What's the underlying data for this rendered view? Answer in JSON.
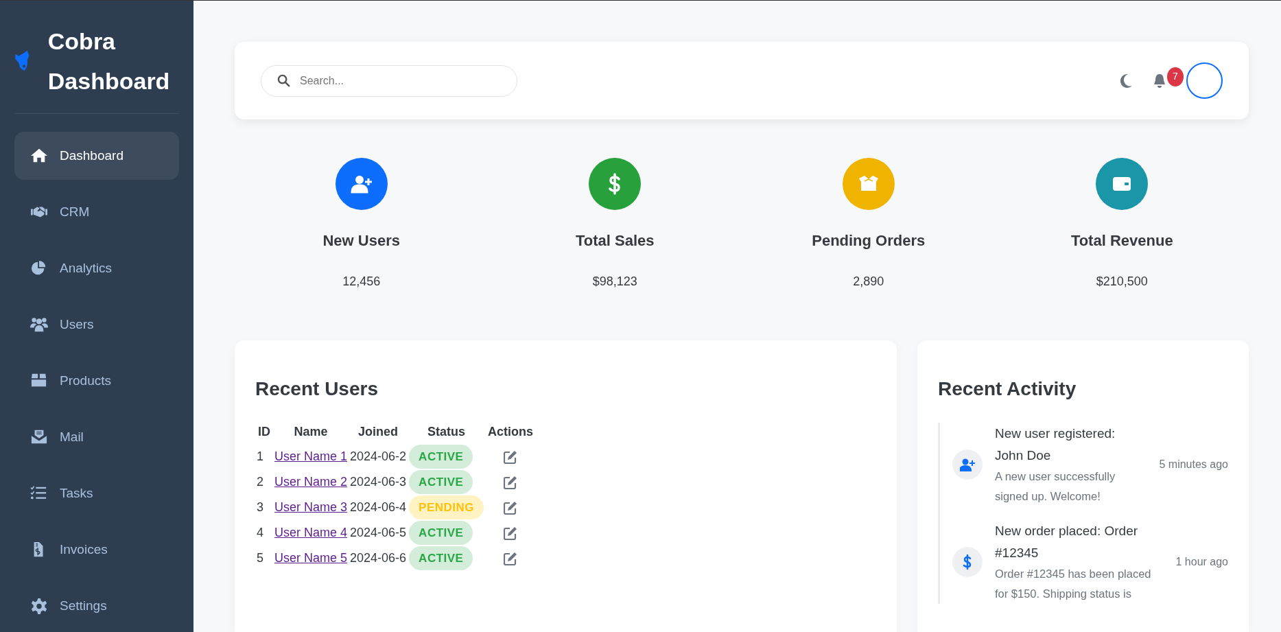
{
  "brand": {
    "title": "Cobra Dashboard"
  },
  "sidebar": {
    "items": [
      {
        "label": "Dashboard",
        "selected": true
      },
      {
        "label": "CRM",
        "selected": false
      },
      {
        "label": "Analytics",
        "selected": false
      },
      {
        "label": "Users",
        "selected": false
      },
      {
        "label": "Products",
        "selected": false
      },
      {
        "label": "Mail",
        "selected": false
      },
      {
        "label": "Tasks",
        "selected": false
      },
      {
        "label": "Invoices",
        "selected": false
      },
      {
        "label": "Settings",
        "selected": false
      }
    ]
  },
  "header": {
    "search": {
      "placeholder": "Search..."
    },
    "notification_count": "7"
  },
  "stats": [
    {
      "label": "New Users",
      "value": "12,456",
      "color": "#0d6efd"
    },
    {
      "label": "Total Sales",
      "value": "$98,123",
      "color": "#28a03c"
    },
    {
      "label": "Pending Orders",
      "value": "2,890",
      "color": "#f0b400"
    },
    {
      "label": "Total Revenue",
      "value": "$210,500",
      "color": "#1a96a8"
    }
  ],
  "recent_users": {
    "title": "Recent Users",
    "columns": [
      "ID",
      "Name",
      "Joined",
      "Status",
      "Actions"
    ],
    "rows": [
      {
        "id": "1",
        "name": "User Name 1",
        "joined": "2024-06-2",
        "status": "ACTIVE",
        "kind": "active"
      },
      {
        "id": "2",
        "name": "User Name 2",
        "joined": "2024-06-3",
        "status": "ACTIVE",
        "kind": "active"
      },
      {
        "id": "3",
        "name": "User Name 3",
        "joined": "2024-06-4",
        "status": "PENDING",
        "kind": "pending"
      },
      {
        "id": "4",
        "name": "User Name 4",
        "joined": "2024-06-5",
        "status": "ACTIVE",
        "kind": "active"
      },
      {
        "id": "5",
        "name": "User Name 5",
        "joined": "2024-06-6",
        "status": "ACTIVE",
        "kind": "active"
      }
    ]
  },
  "recent_activity": {
    "title": "Recent Activity",
    "items": [
      {
        "title": "New user registered: John Doe",
        "description": "A new user successfully signed up. Welcome!",
        "time": "5 minutes ago",
        "kind": "user"
      },
      {
        "title": "New order placed: Order #12345",
        "description": "Order #12345 has been placed for $150. Shipping status is",
        "time": "1 hour ago",
        "kind": "order"
      }
    ]
  }
}
